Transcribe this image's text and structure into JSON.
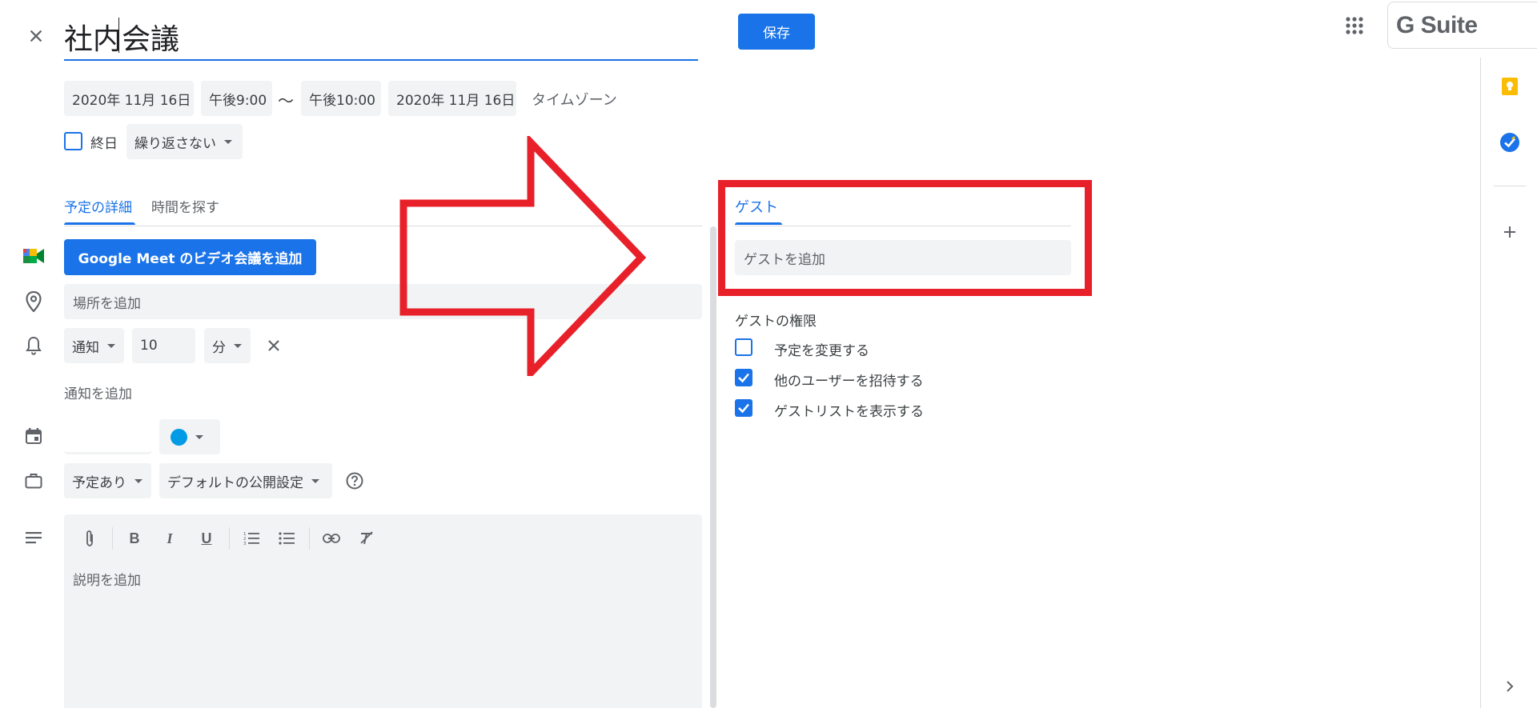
{
  "header": {
    "title": "社内会議",
    "save_label": "保存",
    "brand": "G Suite"
  },
  "datetime": {
    "start_date": "2020年 11月 16日",
    "start_time": "午後9:00",
    "separator": "～",
    "end_time": "午後10:00",
    "end_date": "2020年 11月 16日",
    "timezone_label": "タイムゾーン",
    "all_day_label": "終日",
    "all_day_checked": false,
    "repeat_value": "繰り返さない"
  },
  "tabs": {
    "details": "予定の詳細",
    "find_time": "時間を探す"
  },
  "details": {
    "meet_button": "Google Meet のビデオ会議を追加",
    "location_placeholder": "場所を追加",
    "notification_type": "通知",
    "notification_value": "10",
    "notification_unit": "分",
    "add_notification": "通知を追加",
    "event_color": "#039be5",
    "availability": "予定あり",
    "visibility": "デフォルトの公開設定",
    "description_placeholder": "説明を追加"
  },
  "guests": {
    "tab_label": "ゲスト",
    "add_placeholder": "ゲストを追加",
    "permissions_title": "ゲストの権限",
    "permissions": [
      {
        "label": "予定を変更する",
        "checked": false
      },
      {
        "label": "他のユーザーを招待する",
        "checked": true
      },
      {
        "label": "ゲストリストを表示する",
        "checked": true
      }
    ]
  },
  "colors": {
    "accent": "#1a73e8",
    "annotation": "#e8202a"
  }
}
